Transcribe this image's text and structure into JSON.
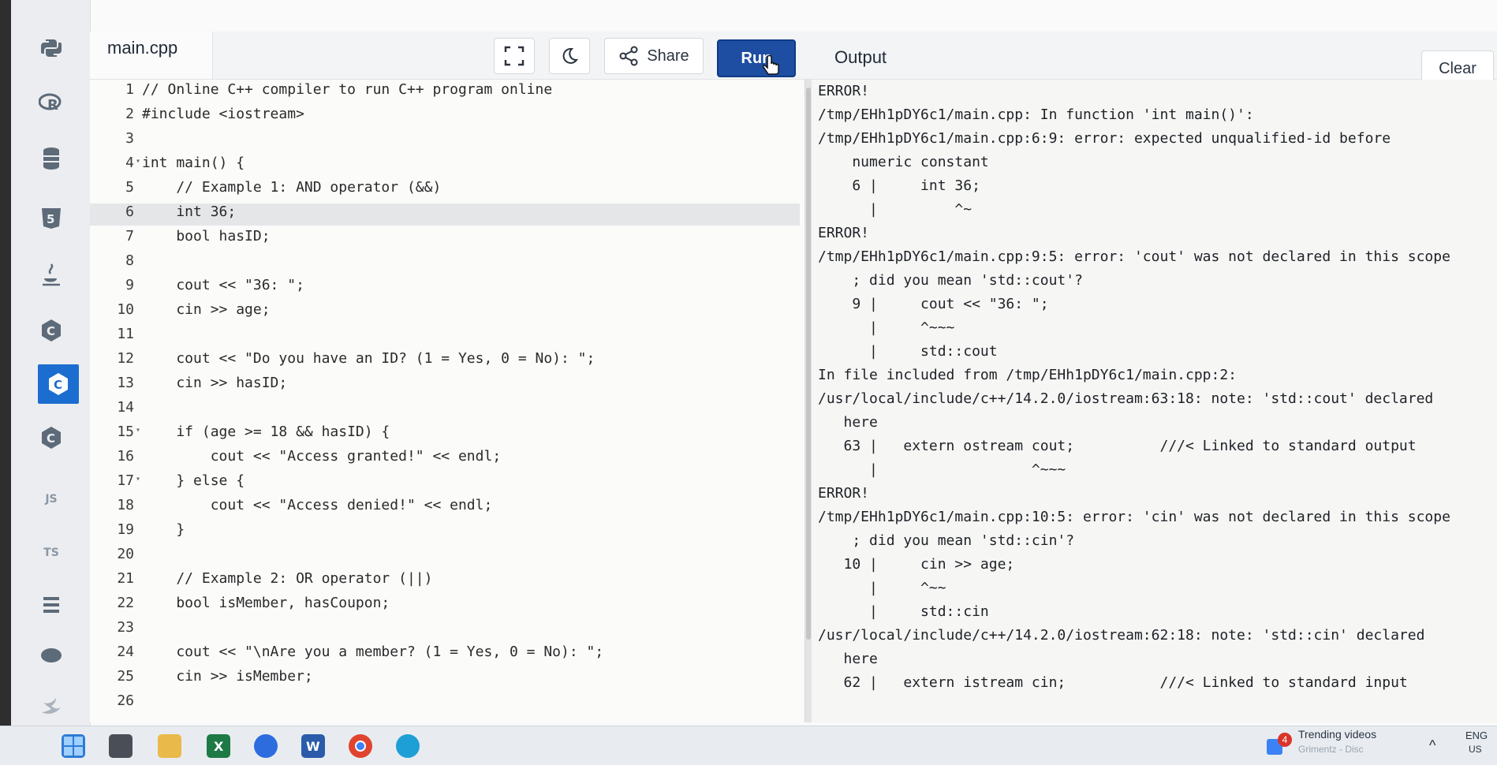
{
  "header": {
    "file_name": "main.cpp",
    "share_label": "Share",
    "run_label": "Run",
    "output_label": "Output",
    "clear_label": "Clear"
  },
  "sidebar": {
    "items": [
      {
        "name": "python-icon",
        "glyph": "◆"
      },
      {
        "name": "r-lang-icon",
        "glyph": "R"
      },
      {
        "name": "sql-icon",
        "glyph": "▤"
      },
      {
        "name": "html5-icon",
        "glyph": "5"
      },
      {
        "name": "java-icon",
        "glyph": "♨"
      },
      {
        "name": "c-lang-icon",
        "glyph": "C"
      },
      {
        "name": "cpp-icon",
        "glyph": "C"
      },
      {
        "name": "csharp-icon",
        "glyph": "C"
      },
      {
        "name": "javascript-icon",
        "glyph": "JS"
      },
      {
        "name": "typescript-icon",
        "glyph": "TS"
      },
      {
        "name": "go-icon",
        "glyph": "≡"
      },
      {
        "name": "php-icon",
        "glyph": "●"
      },
      {
        "name": "swift-icon",
        "glyph": "◢"
      }
    ]
  },
  "code_lines": [
    {
      "n": "1",
      "text": "// Online C++ compiler to run C++ program online"
    },
    {
      "n": "2",
      "text": "#include <iostream>"
    },
    {
      "n": "3",
      "text": ""
    },
    {
      "n": "4",
      "fold": "▾",
      "text": "int main() {"
    },
    {
      "n": "5",
      "text": "    // Example 1: AND operator (&&)"
    },
    {
      "n": "6",
      "text": "    int 36;",
      "hl": true
    },
    {
      "n": "7",
      "text": "    bool hasID;"
    },
    {
      "n": "8",
      "text": ""
    },
    {
      "n": "9",
      "text": "    cout << \"36: \";"
    },
    {
      "n": "10",
      "text": "    cin >> age;"
    },
    {
      "n": "11",
      "text": ""
    },
    {
      "n": "12",
      "text": "    cout << \"Do you have an ID? (1 = Yes, 0 = No): \";"
    },
    {
      "n": "13",
      "text": "    cin >> hasID;"
    },
    {
      "n": "14",
      "text": ""
    },
    {
      "n": "15",
      "fold": "▾",
      "text": "    if (age >= 18 && hasID) {"
    },
    {
      "n": "16",
      "text": "        cout << \"Access granted!\" << endl;"
    },
    {
      "n": "17",
      "fold": "▾",
      "text": "    } else {"
    },
    {
      "n": "18",
      "text": "        cout << \"Access denied!\" << endl;"
    },
    {
      "n": "19",
      "text": "    }"
    },
    {
      "n": "20",
      "text": ""
    },
    {
      "n": "21",
      "text": "    // Example 2: OR operator (||)"
    },
    {
      "n": "22",
      "text": "    bool isMember, hasCoupon;"
    },
    {
      "n": "23",
      "text": ""
    },
    {
      "n": "24",
      "text": "    cout << \"\\nAre you a member? (1 = Yes, 0 = No): \";"
    },
    {
      "n": "25",
      "text": "    cin >> isMember;"
    },
    {
      "n": "26",
      "text": ""
    }
  ],
  "output_lines": [
    "ERROR!",
    "/tmp/EHh1pDY6c1/main.cpp: In function 'int main()':",
    "/tmp/EHh1pDY6c1/main.cpp:6:9: error: expected unqualified-id before",
    "    numeric constant",
    "    6 |     int 36;",
    "      |         ^~",
    "ERROR!",
    "/tmp/EHh1pDY6c1/main.cpp:9:5: error: 'cout' was not declared in this scope",
    "    ; did you mean 'std::cout'?",
    "    9 |     cout << \"36: \";",
    "      |     ^~~~",
    "      |     std::cout",
    "In file included from /tmp/EHh1pDY6c1/main.cpp:2:",
    "/usr/local/include/c++/14.2.0/iostream:63:18: note: 'std::cout' declared",
    "   here",
    "   63 |   extern ostream cout;          ///< Linked to standard output",
    "      |                  ^~~~",
    "ERROR!",
    "/tmp/EHh1pDY6c1/main.cpp:10:5: error: 'cin' was not declared in this scope",
    "    ; did you mean 'std::cin'?",
    "   10 |     cin >> age;",
    "      |     ^~~",
    "      |     std::cin",
    "/usr/local/include/c++/14.2.0/iostream:62:18: note: 'std::cin' declared",
    "   here",
    "   62 |   extern istream cin;           ///< Linked to standard input"
  ],
  "taskbar": {
    "notification_count": "4",
    "trending_label": "Trending videos",
    "trending_sub": "Grimentz - Disc",
    "lang_label": "ENG",
    "lang_sub": "US",
    "chevron": "^"
  }
}
